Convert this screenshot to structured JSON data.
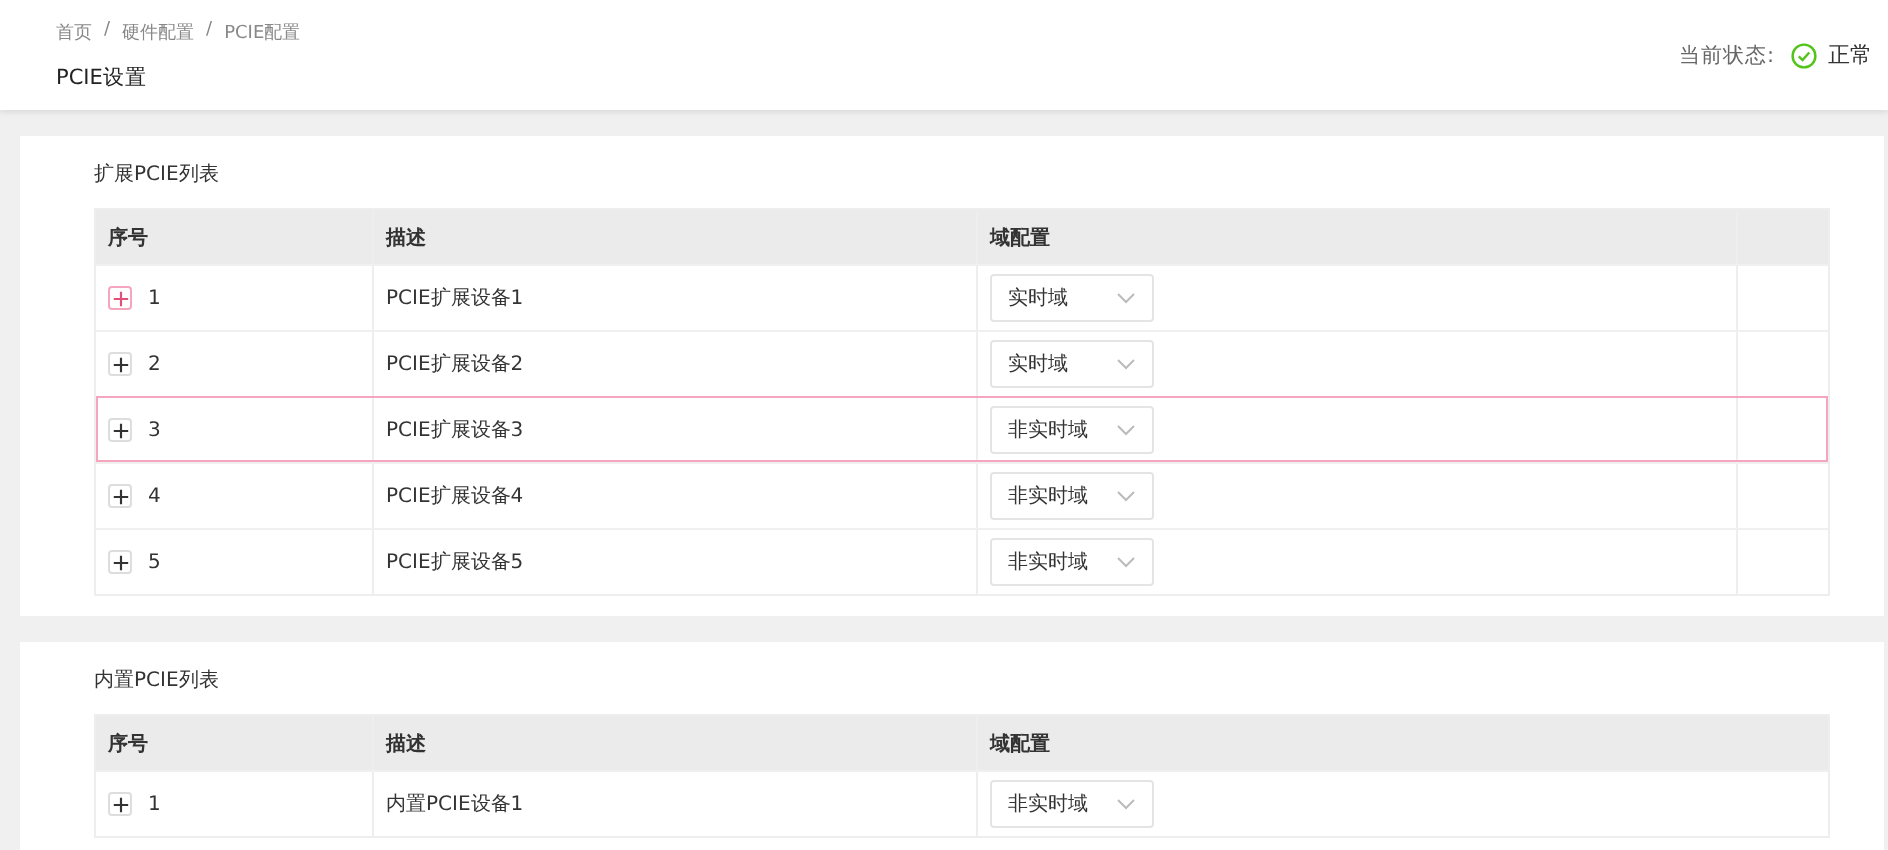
{
  "breadcrumb": [
    "首页",
    "硬件配置",
    "PCIE配置"
  ],
  "breadcrumb_separator": "/",
  "page_title": "PCIE设置",
  "status": {
    "label": "当前状态:",
    "value": "正常"
  },
  "tables": [
    {
      "title": "扩展PCIE列表",
      "columns": [
        "序号",
        "描述",
        "域配置"
      ],
      "extra_column": true,
      "rows": [
        {
          "index": "1",
          "description": "PCIE扩展设备1",
          "domain": "实时域",
          "selected": false,
          "expand_highlighted": true
        },
        {
          "index": "2",
          "description": "PCIE扩展设备2",
          "domain": "实时域",
          "selected": false,
          "expand_highlighted": false
        },
        {
          "index": "3",
          "description": "PCIE扩展设备3",
          "domain": "非实时域",
          "selected": true,
          "expand_highlighted": false
        },
        {
          "index": "4",
          "description": "PCIE扩展设备4",
          "domain": "非实时域",
          "selected": false,
          "expand_highlighted": false
        },
        {
          "index": "5",
          "description": "PCIE扩展设备5",
          "domain": "非实时域",
          "selected": false,
          "expand_highlighted": false
        }
      ]
    },
    {
      "title": "内置PCIE列表",
      "columns": [
        "序号",
        "描述",
        "域配置"
      ],
      "extra_column": false,
      "rows": [
        {
          "index": "1",
          "description": "内置PCIE设备1",
          "domain": "非实时域",
          "selected": false,
          "expand_highlighted": false
        }
      ]
    }
  ]
}
